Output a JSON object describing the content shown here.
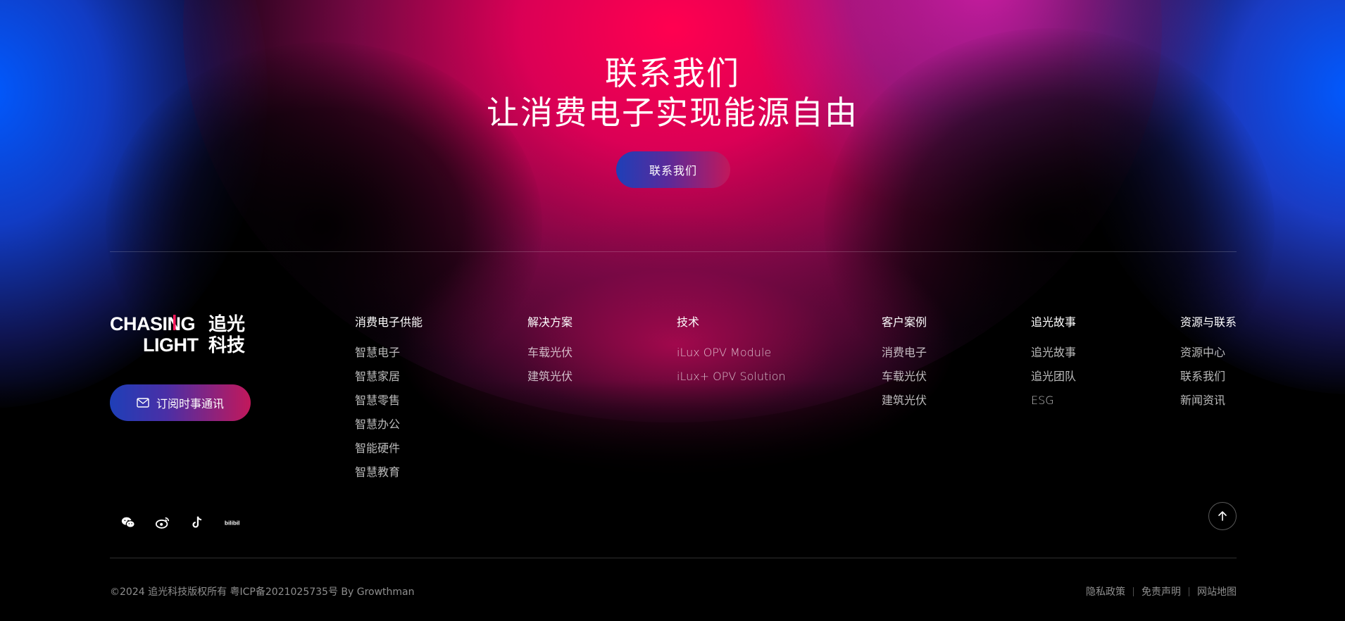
{
  "hero": {
    "title_line1": "联系我们",
    "title_line2": "让消费电子实现能源自由",
    "cta_label": "联系我们"
  },
  "brand": {
    "logo_line1": "CHASING",
    "logo_line2": "LIGHT",
    "logo_cn1": "追光",
    "logo_cn2": "科技",
    "accent_colors": [
      "#1e3fb8",
      "#c2185b",
      "#ff0050"
    ]
  },
  "subscribe": {
    "label": "订阅时事通讯",
    "icon": "mail-icon"
  },
  "nav": [
    {
      "heading": "消费电子供能",
      "items": [
        "智慧电子",
        "智慧家居",
        "智慧零售",
        "智慧办公",
        "智能硬件",
        "智慧教育"
      ]
    },
    {
      "heading": "解决方案",
      "items": [
        "车载光伏",
        "建筑光伏"
      ]
    },
    {
      "heading": "技术",
      "items": [
        "iLux OPV Module",
        "iLux+ OPV Solution"
      ]
    },
    {
      "heading": "客户案例",
      "items": [
        "消费电子",
        "车载光伏",
        "建筑光伏"
      ]
    },
    {
      "heading": "追光故事",
      "items": [
        "追光故事",
        "追光团队",
        "ESG"
      ]
    },
    {
      "heading": "资源与联系",
      "items": [
        "资源中心",
        "联系我们",
        "新闻资讯"
      ]
    }
  ],
  "socials": [
    "wechat-icon",
    "weibo-icon",
    "douyin-icon",
    "bilibili-icon"
  ],
  "footer": {
    "copyright": "©2024 追光科技版权所有  粤ICP备2021025735号 By Growthman",
    "legal": [
      "隐私政策",
      "免责声明",
      "网站地图"
    ]
  }
}
